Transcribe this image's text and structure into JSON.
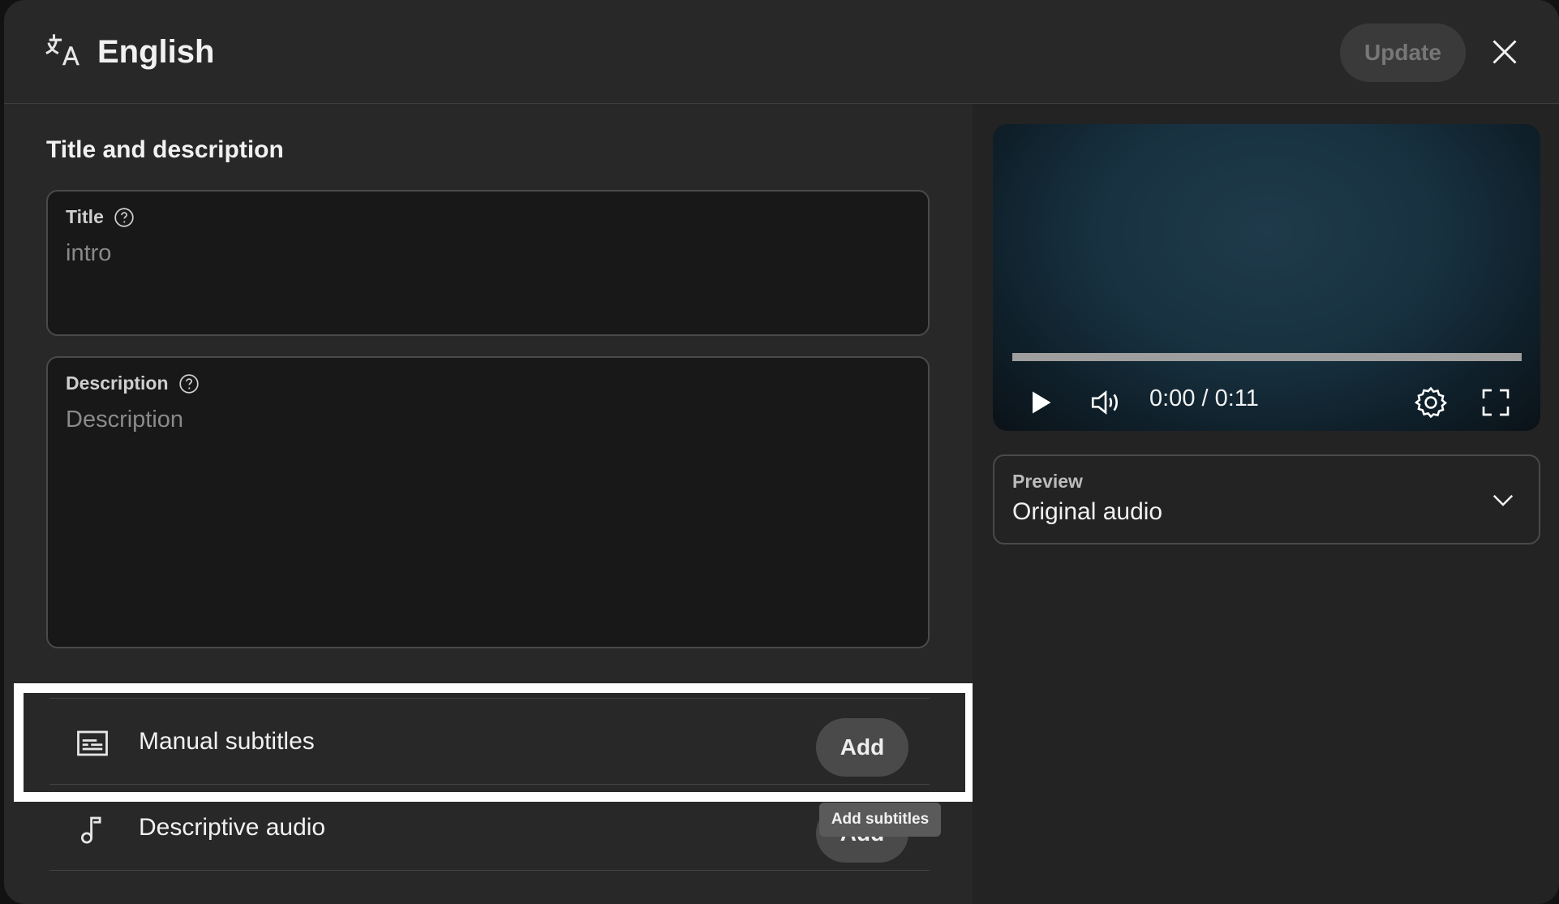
{
  "header": {
    "language": "English",
    "update_label": "Update"
  },
  "details": {
    "section_title": "Title and description",
    "title_field": {
      "label": "Title",
      "value": "intro"
    },
    "description_field": {
      "label": "Description",
      "placeholder": "Description"
    }
  },
  "rows": [
    {
      "label": "Manual subtitles",
      "button": "Add"
    },
    {
      "label": "Descriptive audio",
      "button": "Add"
    }
  ],
  "tooltip": "Add subtitles",
  "player": {
    "time": "0:00 / 0:11",
    "progress_fraction": 0
  },
  "preview": {
    "label": "Preview",
    "value": "Original audio"
  },
  "icons": {
    "language": "translate-icon",
    "close": "close-icon",
    "help": "help-circle-icon",
    "subtitles": "subtitles-icon",
    "audio": "music-note-icon",
    "play": "play-icon",
    "volume": "volume-icon",
    "settings": "gear-icon",
    "fullscreen": "fullscreen-icon",
    "chevron": "chevron-down-icon"
  }
}
